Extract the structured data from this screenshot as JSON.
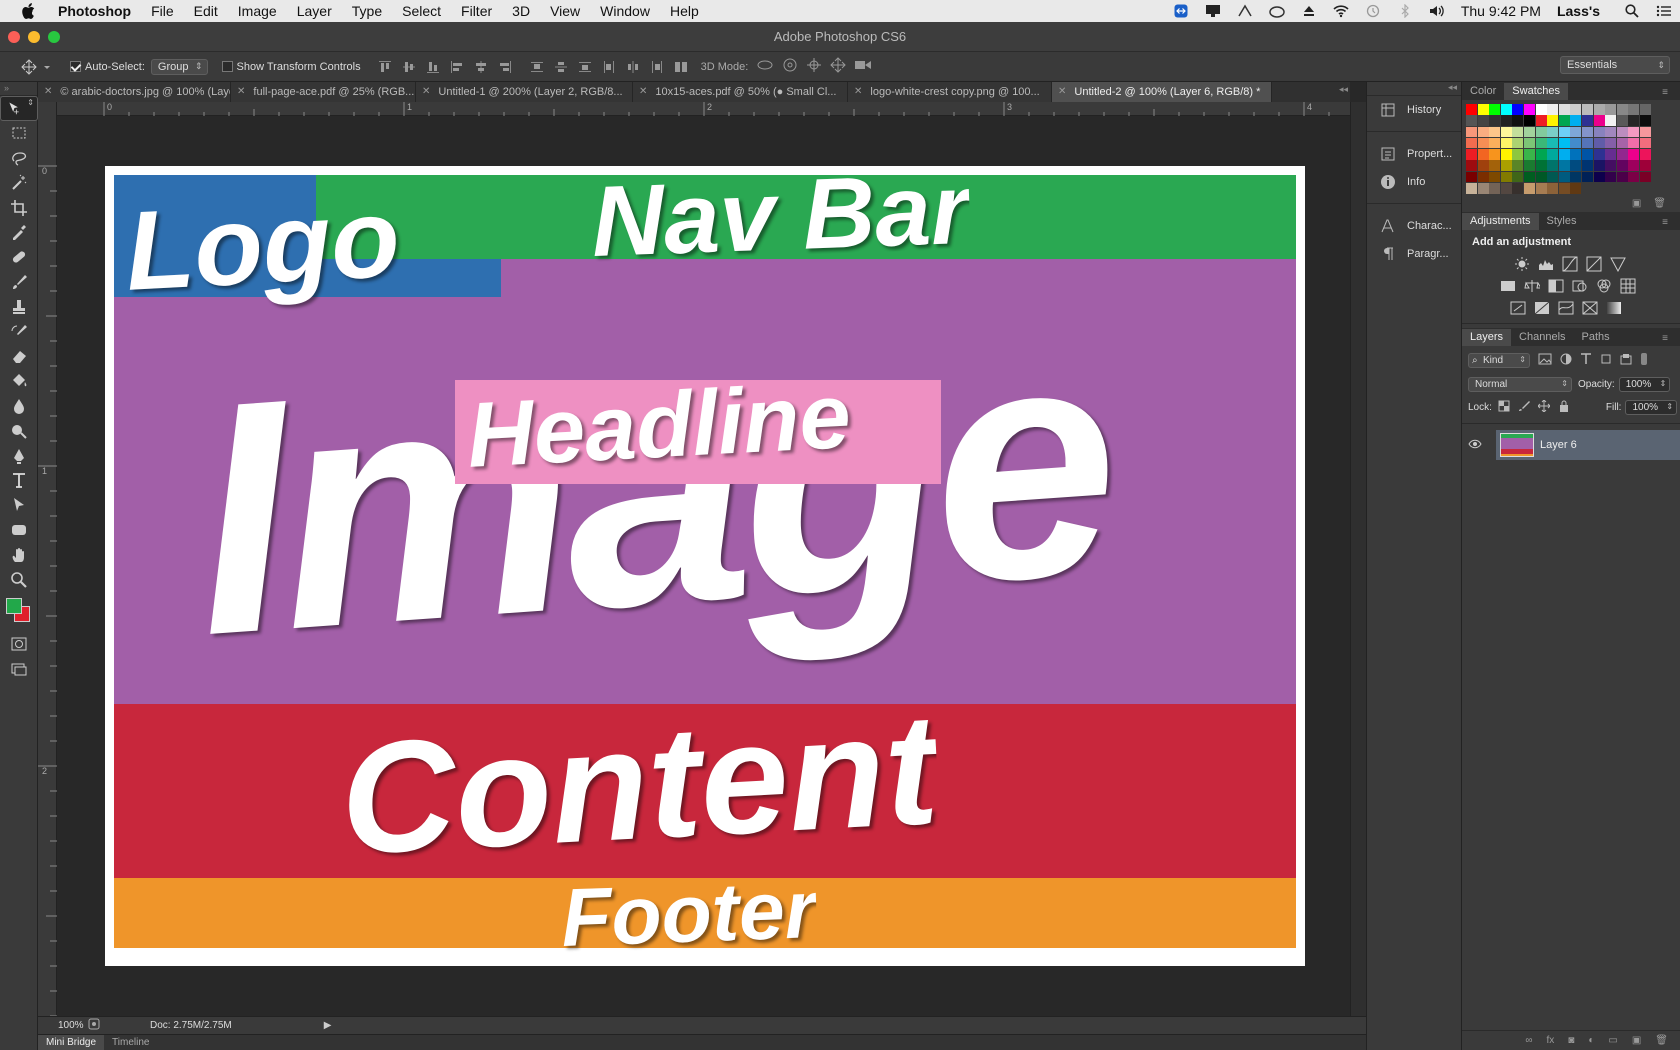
{
  "menubar": {
    "app": "Photoshop",
    "items": [
      "File",
      "Edit",
      "Image",
      "Layer",
      "Type",
      "Select",
      "Filter",
      "3D",
      "View",
      "Window",
      "Help"
    ],
    "clock": "Thu 9:42 PM",
    "user": "Lass's"
  },
  "window": {
    "title": "Adobe Photoshop CS6"
  },
  "options": {
    "auto_select_label": "Auto-Select:",
    "auto_select_value": "Group",
    "transform_label": "Show Transform Controls",
    "mode_label": "3D Mode:",
    "workspace": "Essentials"
  },
  "tabs": [
    {
      "label": "© arabic-doctors.jpg @ 100% (Laye..."
    },
    {
      "label": "full-page-ace.pdf @ 25% (RGB..."
    },
    {
      "label": "Untitled-1 @ 200% (Layer 2, RGB/8..."
    },
    {
      "label": "10x15-aces.pdf @ 50% (● Small Cl..."
    },
    {
      "label": "logo-white-crest copy.png @ 100..."
    },
    {
      "label": "Untitled-2 @ 100% (Layer 6, RGB/8) *"
    }
  ],
  "rulers": {
    "h": [
      "0",
      "1",
      "2",
      "3",
      "4"
    ],
    "v": [
      "0",
      "1",
      "2"
    ]
  },
  "canvas": {
    "logo": "Logo",
    "nav": "Nav Bar",
    "image": "Image",
    "headline": "Headline",
    "content": "Content",
    "footer": "Footer",
    "colors": {
      "logo": "#2e6fb0",
      "nav": "#2aa852",
      "image": "#a25fa8",
      "headline": "#ee90c2",
      "content": "#c8273c",
      "footer": "#ef952a"
    }
  },
  "status": {
    "zoom": "100%",
    "doc": "Doc: 2.75M/2.75M"
  },
  "bottom_tabs": {
    "mini_bridge": "Mini Bridge",
    "timeline": "Timeline"
  },
  "dock": {
    "history": "History",
    "properties": "Propert...",
    "info": "Info",
    "character": "Charac...",
    "paragraph": "Paragr..."
  },
  "panels": {
    "color_tab": "Color",
    "swatches_tab": "Swatches",
    "adjustments_tab": "Adjustments",
    "styles_tab": "Styles",
    "add_adjustment": "Add an adjustment",
    "layers_tab": "Layers",
    "channels_tab": "Channels",
    "paths_tab": "Paths",
    "kind": "Kind",
    "blend_mode": "Normal",
    "opacity_label": "Opacity:",
    "opacity": "100%",
    "lock_label": "Lock:",
    "fill_label": "Fill:",
    "fill": "100%",
    "layer_name": "Layer 6"
  }
}
